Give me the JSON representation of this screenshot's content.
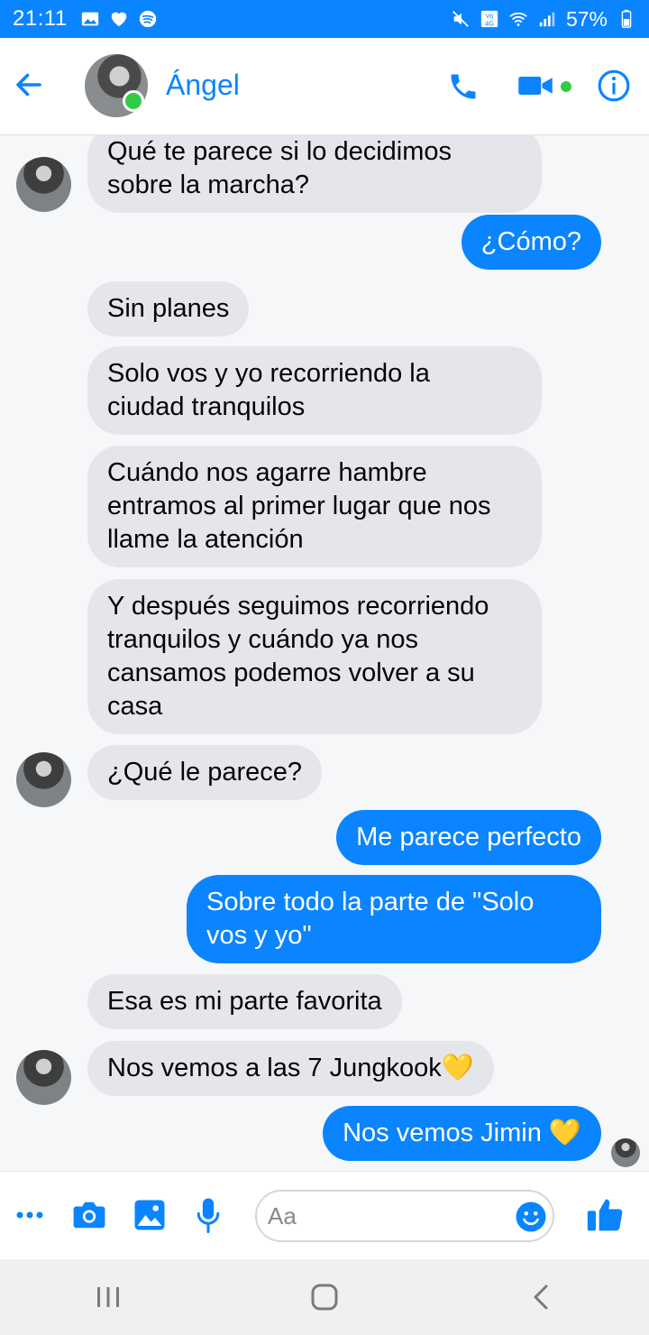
{
  "status_bar": {
    "time": "21:11",
    "battery": "57%",
    "left_icons": [
      "gallery-icon",
      "heart-icon",
      "spotify-icon"
    ],
    "right_icons": [
      "mute-icon",
      "volte-icon",
      "wifi-icon",
      "signal-icon",
      "battery-icon"
    ]
  },
  "header": {
    "contact_name": "Ángel",
    "online": true,
    "accent_color": "#0a84ff"
  },
  "messages": [
    {
      "direction": "in",
      "lines": [
        "Qué te parece si lo decidimos",
        "sobre la marcha?"
      ],
      "avatar": true
    },
    {
      "direction": "out",
      "lines": [
        "¿Cómo?"
      ]
    },
    {
      "direction": "in",
      "lines": [
        "Sin planes"
      ]
    },
    {
      "direction": "in",
      "lines": [
        "Solo vos y yo recorriendo la",
        "ciudad tranquilos"
      ]
    },
    {
      "direction": "in",
      "lines": [
        "Cuándo nos agarre hambre",
        "entramos al primer lugar que nos",
        "llame la atención"
      ]
    },
    {
      "direction": "in",
      "lines": [
        "Y después seguimos recorriendo",
        "tranquilos y cuándo ya nos",
        "cansamos podemos volver a su",
        "casa"
      ]
    },
    {
      "direction": "in",
      "lines": [
        "¿Qué le parece?"
      ],
      "avatar": true
    },
    {
      "direction": "out",
      "lines": [
        "Me parece perfecto"
      ]
    },
    {
      "direction": "out",
      "lines": [
        "Sobre todo la parte de \"Solo",
        "vos y yo\""
      ]
    },
    {
      "direction": "in",
      "lines": [
        "Esa es mi parte favorita"
      ]
    },
    {
      "direction": "in",
      "text": "Nos vemos a las 7 Jungkook",
      "emoji": "💛",
      "avatar": true
    },
    {
      "direction": "out",
      "text": "Nos vemos Jimin ",
      "emoji": "💛",
      "seen": true
    }
  ],
  "composer": {
    "placeholder": "Aa",
    "icons": [
      "more-icon",
      "camera-icon",
      "image-icon",
      "microphone-icon",
      "emoji-icon",
      "like-icon"
    ]
  },
  "nav_bar": {
    "buttons": [
      "recent-apps-icon",
      "home-icon",
      "back-icon"
    ]
  }
}
